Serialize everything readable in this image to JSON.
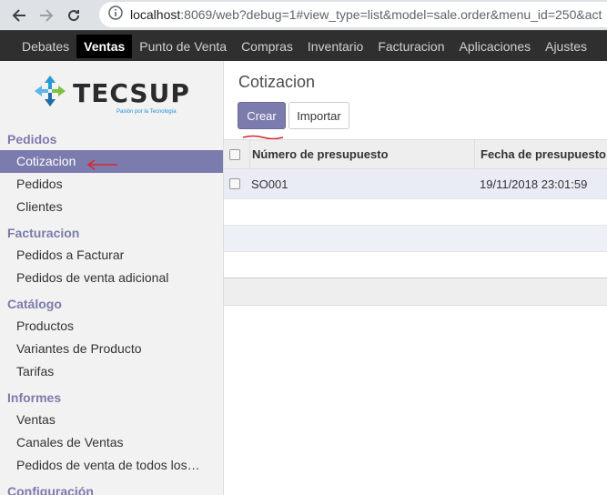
{
  "browser": {
    "url_host": "localhost",
    "url_rest": ":8069/web?debug=1#view_type=list&model=sale.order&menu_id=250&act"
  },
  "topmenu": {
    "items": [
      "Debates",
      "Ventas",
      "Punto de Venta",
      "Compras",
      "Inventario",
      "Facturacion",
      "Aplicaciones",
      "Ajustes"
    ],
    "active": "Ventas"
  },
  "logo": {
    "text": "TECSUP",
    "tagline": "Pasión por la Tecnología"
  },
  "sidebar": {
    "sections": [
      {
        "title": "Pedidos",
        "items": [
          "Cotizacion",
          "Pedidos",
          "Clientes"
        ]
      },
      {
        "title": "Facturacion",
        "items": [
          "Pedidos a Facturar",
          "Pedidos de venta adicional"
        ]
      },
      {
        "title": "Catálogo",
        "items": [
          "Productos",
          "Variantes de Producto",
          "Tarifas"
        ]
      },
      {
        "title": "Informes",
        "items": [
          "Ventas",
          "Canales de Ventas",
          "Pedidos de venta de todos los…"
        ]
      },
      {
        "title": "Configuración",
        "items": []
      }
    ],
    "active_item": "Cotizacion"
  },
  "main": {
    "breadcrumb": "Cotizacion",
    "create_label": "Crear",
    "import_label": "Importar",
    "columns": [
      "Número de presupuesto",
      "Fecha de presupuesto"
    ],
    "rows": [
      {
        "number": "SO001",
        "date": "19/11/2018 23:01:59"
      }
    ]
  },
  "colors": {
    "accent": "#7c7bad",
    "topbar": "#2f2f2f",
    "annotation": "#d9262f"
  }
}
